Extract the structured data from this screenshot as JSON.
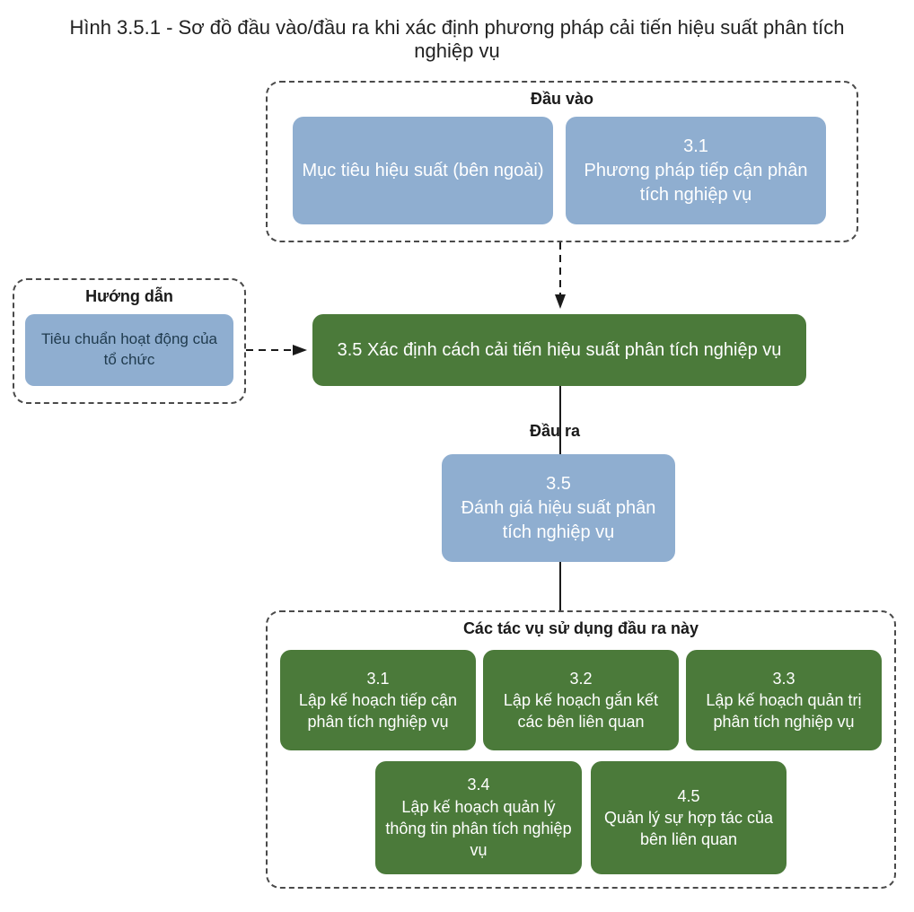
{
  "title": "Hình 3.5.1 - Sơ đồ đầu vào/đầu ra khi xác định phương pháp cải tiến hiệu suất phân tích nghiệp vụ",
  "inputs": {
    "label": "Đầu vào",
    "items": [
      {
        "num": "",
        "text": "Mục tiêu hiệu suất (bên ngoài)"
      },
      {
        "num": "3.1",
        "text": "Phương pháp tiếp cận phân tích nghiệp vụ"
      }
    ]
  },
  "guide": {
    "label": "Hướng dẫn",
    "item": "Tiêu chuẩn hoạt động của tổ chức"
  },
  "center": "3.5 Xác định cách cải tiến hiệu suất phân tích nghiệp vụ",
  "output_label": "Đầu ra",
  "output": {
    "num": "3.5",
    "text": "Đánh giá hiệu suất phân tích nghiệp vụ"
  },
  "tasks": {
    "label": "Các tác vụ sử dụng đầu ra này",
    "items": [
      {
        "num": "3.1",
        "text": "Lập kế hoạch tiếp cận phân tích nghiệp vụ"
      },
      {
        "num": "3.2",
        "text": "Lập kế hoạch gắn kết các bên liên quan"
      },
      {
        "num": "3.3",
        "text": "Lập kế hoạch quản trị phân tích nghiệp vụ"
      },
      {
        "num": "3.4",
        "text": "Lập kế hoạch quản lý thông tin phân tích nghiệp vụ"
      },
      {
        "num": "4.5",
        "text": "Quản lý sự hợp tác của bên liên quan"
      }
    ]
  }
}
